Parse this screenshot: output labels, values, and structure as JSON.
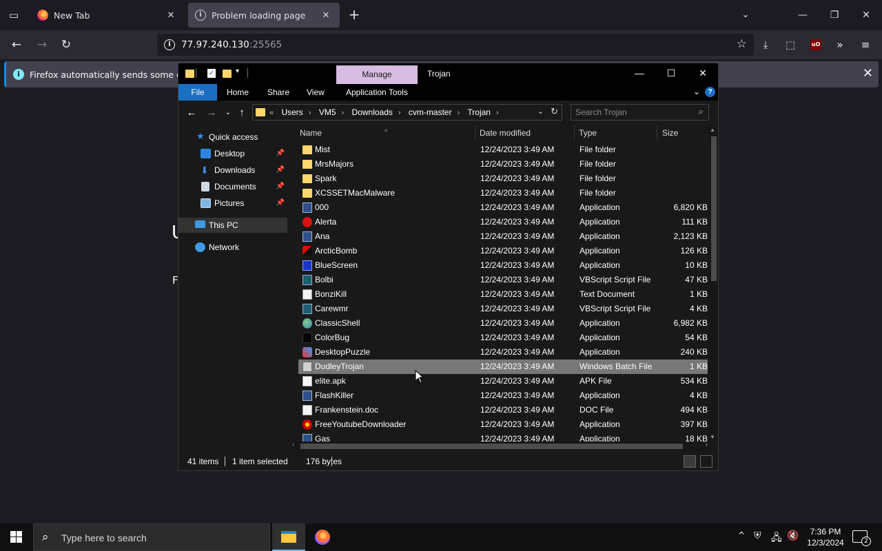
{
  "browser": {
    "tabs": [
      {
        "title": "New Tab",
        "icon": "firefox-icon"
      },
      {
        "title": "Problem loading page",
        "icon": "info-icon"
      }
    ],
    "url_host": "77.97.240.130",
    "url_port": ":25565",
    "notification": "Firefox automatically sends some data to"
  },
  "page_peek": {
    "a": "U",
    "b": "F"
  },
  "explorer": {
    "window_title": "Trojan",
    "context_tab": "Manage",
    "ribbon_tabs": [
      "File",
      "Home",
      "Share",
      "View",
      "Application Tools"
    ],
    "breadcrumb": [
      "Users",
      "VM5",
      "Downloads",
      "cvm-master",
      "Trojan"
    ],
    "breadcrumb_prefix": "«",
    "search_placeholder": "Search Trojan",
    "nav": {
      "quick_access": "Quick access",
      "items": [
        "Desktop",
        "Downloads",
        "Documents",
        "Pictures"
      ],
      "this_pc": "This PC",
      "network": "Network"
    },
    "columns": {
      "name": "Name",
      "date": "Date modified",
      "type": "Type",
      "size": "Size"
    },
    "files": [
      {
        "name": "Mist",
        "date": "12/24/2023 3:49 AM",
        "type": "File folder",
        "size": "",
        "icon": "folder-icon"
      },
      {
        "name": "MrsMajors",
        "date": "12/24/2023 3:49 AM",
        "type": "File folder",
        "size": "",
        "icon": "folder-icon"
      },
      {
        "name": "Spark",
        "date": "12/24/2023 3:49 AM",
        "type": "File folder",
        "size": "",
        "icon": "folder-icon"
      },
      {
        "name": "XCSSETMacMalware",
        "date": "12/24/2023 3:49 AM",
        "type": "File folder",
        "size": "",
        "icon": "folder-icon"
      },
      {
        "name": "000",
        "date": "12/24/2023 3:49 AM",
        "type": "Application",
        "size": "6,820 KB",
        "icon": "application-icon"
      },
      {
        "name": "Alerta",
        "date": "12/24/2023 3:49 AM",
        "type": "Application",
        "size": "111 KB",
        "icon": "stop-sign-icon"
      },
      {
        "name": "Ana",
        "date": "12/24/2023 3:49 AM",
        "type": "Application",
        "size": "2,123 KB",
        "icon": "application-icon"
      },
      {
        "name": "ArcticBomb",
        "date": "12/24/2023 3:49 AM",
        "type": "Application",
        "size": "126 KB",
        "icon": "bomb-icon"
      },
      {
        "name": "BlueScreen",
        "date": "12/24/2023 3:49 AM",
        "type": "Application",
        "size": "10 KB",
        "icon": "bluescreen-icon"
      },
      {
        "name": "Bolbi",
        "date": "12/24/2023 3:49 AM",
        "type": "VBScript Script File",
        "size": "47 KB",
        "icon": "vbscript-icon"
      },
      {
        "name": "BonziKill",
        "date": "12/24/2023 3:49 AM",
        "type": "Text Document",
        "size": "1 KB",
        "icon": "text-document-icon"
      },
      {
        "name": "Carewmr",
        "date": "12/24/2023 3:49 AM",
        "type": "VBScript Script File",
        "size": "4 KB",
        "icon": "vbscript-icon"
      },
      {
        "name": "ClassicShell",
        "date": "12/24/2023 3:49 AM",
        "type": "Application",
        "size": "6,982 KB",
        "icon": "globe-icon"
      },
      {
        "name": "ColorBug",
        "date": "12/24/2023 3:49 AM",
        "type": "Application",
        "size": "54 KB",
        "icon": "black-square-icon"
      },
      {
        "name": "DesktopPuzzle",
        "date": "12/24/2023 3:49 AM",
        "type": "Application",
        "size": "240 KB",
        "icon": "puzzle-icon"
      },
      {
        "name": "DudleyTrojan",
        "date": "12/24/2023 3:49 AM",
        "type": "Windows Batch File",
        "size": "1 KB",
        "icon": "batch-file-icon",
        "selected": true
      },
      {
        "name": "elite.apk",
        "date": "12/24/2023 3:49 AM",
        "type": "APK File",
        "size": "534 KB",
        "icon": "file-icon"
      },
      {
        "name": "FlashKiller",
        "date": "12/24/2023 3:49 AM",
        "type": "Application",
        "size": "4 KB",
        "icon": "application-icon"
      },
      {
        "name": "Frankenstein.doc",
        "date": "12/24/2023 3:49 AM",
        "type": "DOC File",
        "size": "494 KB",
        "icon": "file-icon"
      },
      {
        "name": "FreeYoutubeDownloader",
        "date": "12/24/2023 3:49 AM",
        "type": "Application",
        "size": "397 KB",
        "icon": "youtube-downloader-icon"
      },
      {
        "name": "Gas",
        "date": "12/24/2023 3:49 AM",
        "type": "Application",
        "size": "18 KB",
        "icon": "application-icon"
      }
    ],
    "status": {
      "count": "41 items",
      "selected": "1 item selected",
      "size": "176 bytes"
    }
  },
  "taskbar": {
    "search_placeholder": "Type here to search",
    "time": "7:36 PM",
    "date": "12/3/2024",
    "notification_count": "2"
  }
}
